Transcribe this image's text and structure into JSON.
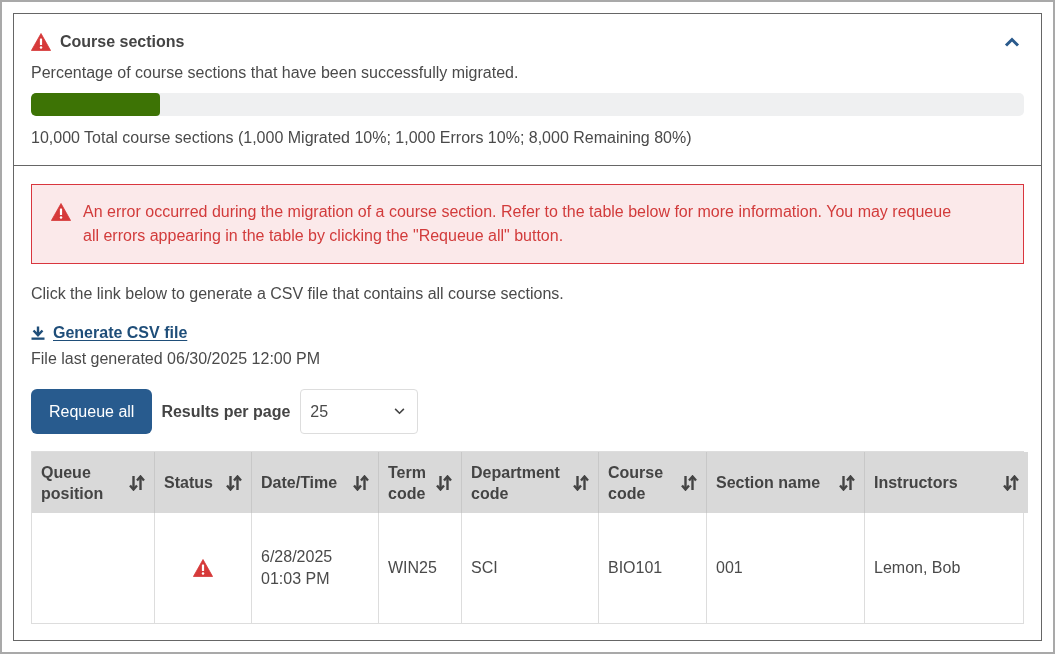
{
  "section": {
    "title": "Course sections",
    "has_error": true,
    "expanded": true,
    "description": "Percentage of course sections that have been successfully migrated.",
    "progress": {
      "level": 0.13
    },
    "summary": "10,000 Total course sections (1,000 Migrated 10%; 1,000 Errors 10%; 8,000 Remaining 80%)"
  },
  "alert": {
    "message": "An error occurred during the migration of a course section. Refer to the table below for more information. You may requeue all errors appearing in the table by clicking the \"Requeue all\" button."
  },
  "csv": {
    "instructions": "Click the link below to generate a CSV file that contains all course sections.",
    "link": "Generate CSV file",
    "last_generated": "File last generated 06/30/2025 12:00 PM"
  },
  "controls": {
    "requeue_button": "Requeue all",
    "results_label": "Results per page",
    "results_select": {
      "value": "25"
    }
  },
  "table": {
    "columns": [
      "Queue position",
      "Status",
      "Date/Time",
      "Term code",
      "Department code",
      "Course code",
      "Section name",
      "Instructors"
    ],
    "rows": [
      {
        "has_error": true,
        "date_time": "6/28/2025 01:03 PM",
        "term_code": "WIN25",
        "department_code": "SCI",
        "course_code": "BIO101",
        "section_name": "001",
        "instructors": "Lemon, Bob"
      }
    ]
  }
}
